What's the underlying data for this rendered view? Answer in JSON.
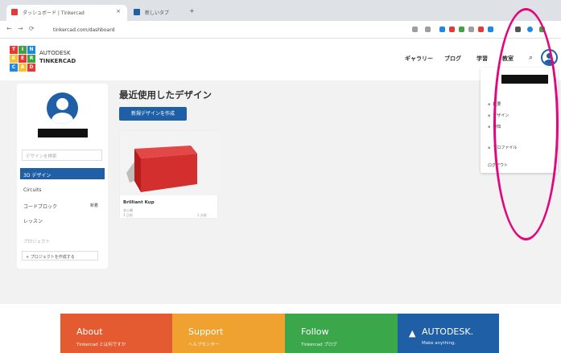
{
  "browser": {
    "tabs": [
      {
        "label": "ダッシュボード | Tinkercad"
      },
      {
        "label": "新しいタブ"
      }
    ],
    "url": "tinkercad.com/dashboard",
    "new_tab_symbol": "+",
    "close_symbol": "×",
    "nav": {
      "back": "←",
      "forward": "→",
      "reload": "⟳",
      "lock": "🔒"
    }
  },
  "header": {
    "brand_line1": "AUTODESK",
    "brand_line2": "TINKERCAD",
    "logo_letters": [
      "T",
      "I",
      "N",
      "K",
      "E",
      "R",
      "C",
      "A",
      "D"
    ],
    "logo_colors": [
      "#e53935",
      "#43a047",
      "#1e88e5",
      "#fbc02d",
      "#e53935",
      "#43a047",
      "#1e88e5",
      "#fbc02d",
      "#e53935"
    ],
    "nav": [
      "ギャラリー",
      "ブログ",
      "学習",
      "教室"
    ],
    "search_icon": "⌕"
  },
  "sidebar": {
    "search_placeholder": "デザインを検索",
    "items": [
      {
        "label": "3D デザイン",
        "active": true
      },
      {
        "label": "Circuits",
        "active": false
      },
      {
        "label": "コードブロック",
        "badge": "新着",
        "active": false
      },
      {
        "label": "レッスン",
        "active": false
      }
    ],
    "projects_label": "プロジェクト",
    "new_project_label": "+ プロジェクトを作成する"
  },
  "main": {
    "title": "最近使用したデザイン",
    "new_design_button": "新規デザインを作成",
    "designs": [
      {
        "name": "Brilliant Kup",
        "meta1": "非公開",
        "meta2": "3 日前",
        "time": "1 分前"
      }
    ]
  },
  "dropdown": {
    "items": [
      {
        "icon": "▪",
        "label": "概要"
      },
      {
        "icon": "▪",
        "label": "デザイン"
      },
      {
        "icon": "▪",
        "label": "通知"
      },
      {
        "icon": "▪",
        "label": "プロファイル"
      },
      {
        "icon": "",
        "label": "ログアウト"
      }
    ]
  },
  "footer": {
    "boxes": [
      {
        "title": "About",
        "sub": "Tinkercad とは何ですか",
        "color": "#e45a31"
      },
      {
        "title": "Support",
        "sub": "ヘルプセンター",
        "color": "#f0a231"
      },
      {
        "title": "Follow",
        "sub": "Tinkercad ブログ",
        "color": "#3aa84a"
      },
      {
        "title": "AUTODESK.",
        "sub": "Make anything.",
        "color": "#1f5fa6"
      }
    ]
  },
  "colors": {
    "accent": "#1f5fa6",
    "annotation": "#e0087c"
  }
}
